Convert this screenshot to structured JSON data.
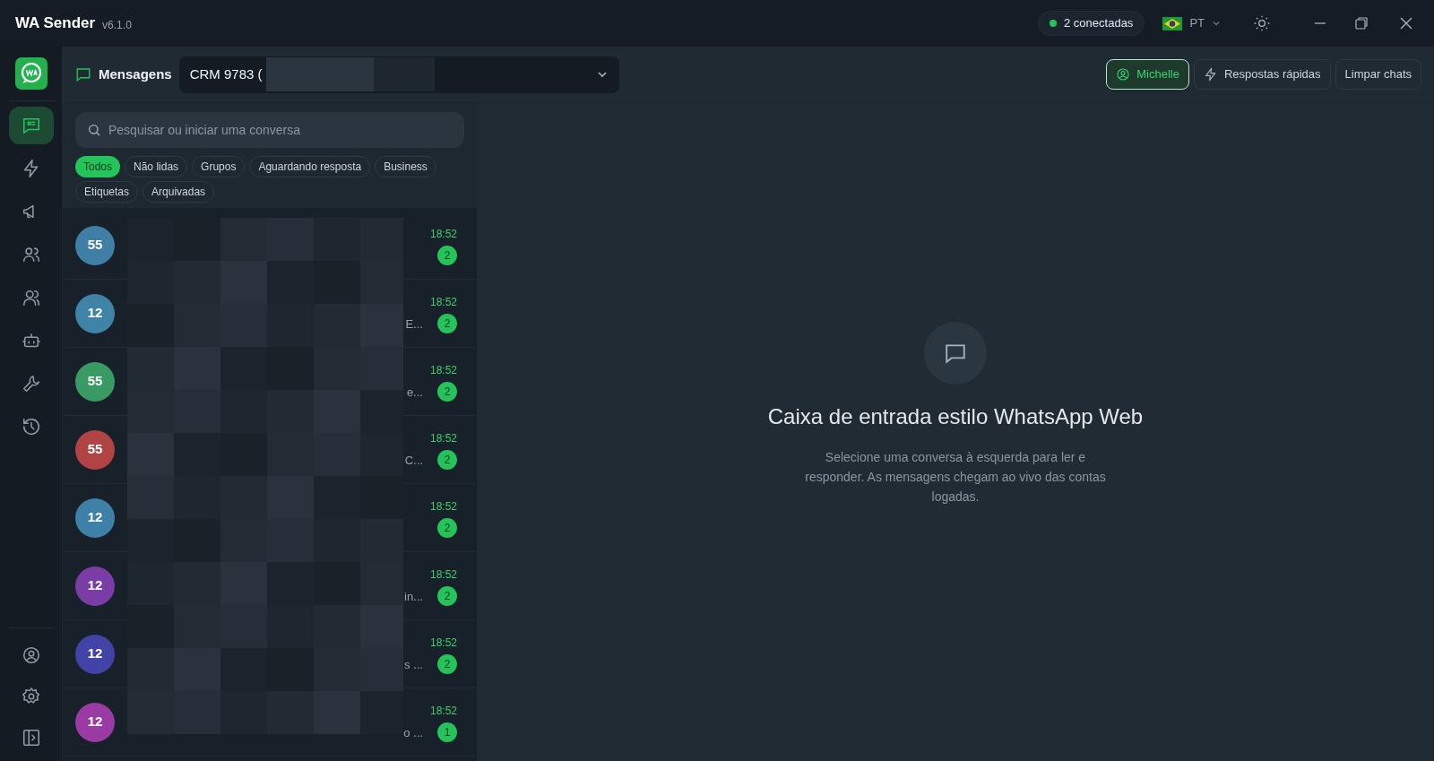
{
  "titlebar": {
    "app_name": "WA Sender",
    "version": "v6.1.0",
    "status": "2 conectadas",
    "language": "PT"
  },
  "rail": {
    "items": [
      {
        "kind": "chat",
        "selected": true
      },
      {
        "kind": "bolt",
        "selected": false
      },
      {
        "kind": "megaphone",
        "selected": false
      },
      {
        "kind": "users",
        "selected": false
      },
      {
        "kind": "group",
        "selected": false
      },
      {
        "kind": "bot",
        "selected": false
      },
      {
        "kind": "wrench",
        "selected": false
      },
      {
        "kind": "history",
        "selected": false
      }
    ],
    "bottom_items": [
      {
        "kind": "account"
      },
      {
        "kind": "settings"
      },
      {
        "kind": "panel"
      }
    ]
  },
  "header": {
    "title": "Mensagens",
    "account_select": "CRM 9783 (",
    "buttons": [
      {
        "label": "Michelle",
        "kind": "profile",
        "selected": true
      },
      {
        "label": "Respostas rápidas",
        "kind": "quick_replies",
        "selected": false
      },
      {
        "label": "Limpar chats",
        "kind": "clear",
        "selected": false
      }
    ]
  },
  "search": {
    "placeholder": "Pesquisar ou iniciar uma conversa"
  },
  "filters": [
    {
      "label": "Todos",
      "selected": true
    },
    {
      "label": "Não lidas",
      "selected": false
    },
    {
      "label": "Grupos",
      "selected": false
    },
    {
      "label": "Aguardando resposta",
      "selected": false
    },
    {
      "label": "Business",
      "selected": false
    },
    {
      "label": "Etiquetas",
      "selected": false
    },
    {
      "label": "Arquivadas",
      "selected": false
    }
  ],
  "chats": [
    {
      "avatar": "55",
      "color": "#3f7fa6",
      "time": "18:52",
      "unread": "2"
    },
    {
      "avatar": "12",
      "color": "#3f84a6",
      "time": "18:52",
      "unread": "2",
      "preview": "E..."
    },
    {
      "avatar": "55",
      "color": "#3a9a63",
      "time": "18:52",
      "unread": "2",
      "preview": "e..."
    },
    {
      "avatar": "55",
      "color": "#b04444",
      "time": "18:52",
      "unread": "2",
      "preview": "C..."
    },
    {
      "avatar": "12",
      "color": "#3f80a8",
      "time": "18:52",
      "unread": "2"
    },
    {
      "avatar": "12",
      "color": "#7a3da6",
      "time": "18:52",
      "unread": "2",
      "preview": "in..."
    },
    {
      "avatar": "12",
      "color": "#4243a6",
      "time": "18:52",
      "unread": "2",
      "preview": "s ..."
    },
    {
      "avatar": "12",
      "color": "#9a3aa3",
      "time": "18:52",
      "unread": "1",
      "preview": "o ..."
    }
  ],
  "empty_state": {
    "title": "Caixa de entrada estilo WhatsApp Web",
    "text": "Selecione uma conversa à esquerda para ler e responder. As mensagens chegam ao vivo das contas logadas."
  }
}
